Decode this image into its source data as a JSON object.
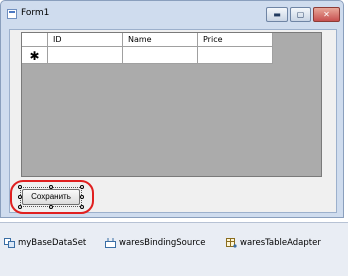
{
  "window": {
    "title": "Form1",
    "buttons": {
      "minimize": "▬",
      "maximize": "▢",
      "close": "✕"
    }
  },
  "grid": {
    "columns": [
      "ID",
      "Name",
      "Price"
    ],
    "new_row_marker": "✱"
  },
  "form": {
    "save_button_label": "Сохранить"
  },
  "tray": {
    "components": [
      "myBaseDataSet",
      "waresBindingSource",
      "waresTableAdapter"
    ]
  },
  "colors": {
    "highlight": "#e02020",
    "grid_background": "#ababab",
    "window_frame": "#cfdcee"
  }
}
